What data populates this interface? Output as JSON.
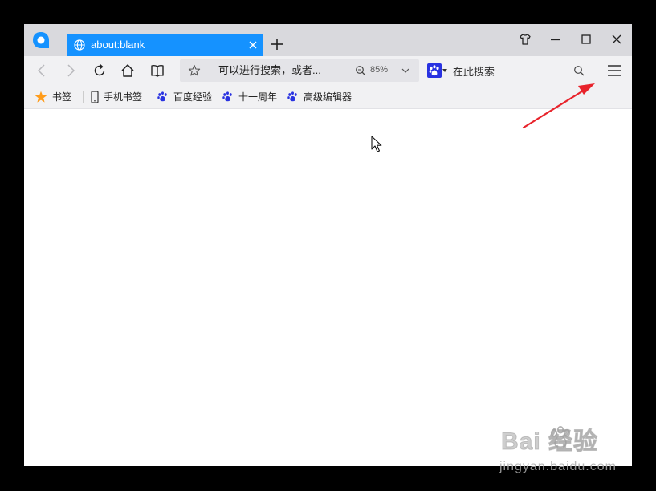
{
  "browser": {
    "tab": {
      "title": "about:blank"
    }
  },
  "toolbar": {
    "address_text": "可以进行搜索，或者...",
    "zoom": "85%",
    "search_placeholder": "在此搜索"
  },
  "bookmarks": {
    "items": [
      {
        "label": "书签",
        "icon": "star-icon"
      },
      {
        "label": "手机书签",
        "icon": "phone-icon"
      },
      {
        "label": "百度经验",
        "icon": "baidu-paw-icon"
      },
      {
        "label": "十一周年",
        "icon": "baidu-paw-icon"
      },
      {
        "label": "高级编辑器",
        "icon": "baidu-paw-icon"
      }
    ]
  },
  "watermark": {
    "brand": "Bai  经验",
    "sub": "jingyan.baidu.com"
  },
  "colors": {
    "tab_active": "#1592ff",
    "annotation_arrow": "#e8232b",
    "bookmark_star": "#ff9c1a",
    "baidu_blue": "#2932e1"
  }
}
